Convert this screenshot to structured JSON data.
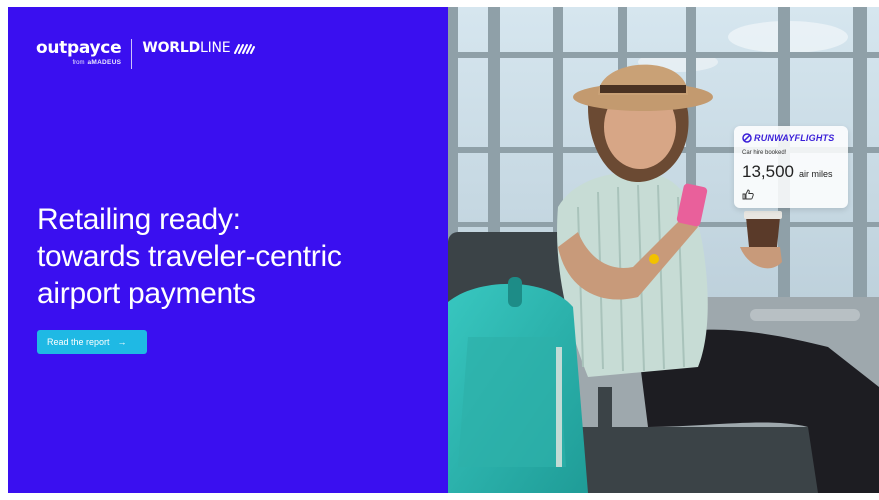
{
  "brand": {
    "outpayce": "outpayce",
    "from": "from",
    "amadeus": "aMADEUS",
    "worldline_bold": "WORLD",
    "worldline_light": "LINE"
  },
  "hero": {
    "headline_line1": "Retailing ready:",
    "headline_line2": "towards traveler-centric",
    "headline_line3": "airport payments",
    "cta_label": "Read the report",
    "cta_arrow": "→"
  },
  "notification": {
    "brand": "RUNWAYFLIGHTS",
    "status": "Car hire booked!",
    "miles_value": "13,500",
    "miles_unit": "air miles"
  },
  "colors": {
    "primary": "#3a0ff0",
    "accent": "#1fb9e4",
    "card_brand": "#3a1fd8"
  },
  "icons": {
    "logo_mark": "worldline-waves-icon",
    "card_logo": "runwayflights-logo-icon",
    "thumb": "thumbs-up-icon",
    "arrow": "arrow-right-icon"
  }
}
